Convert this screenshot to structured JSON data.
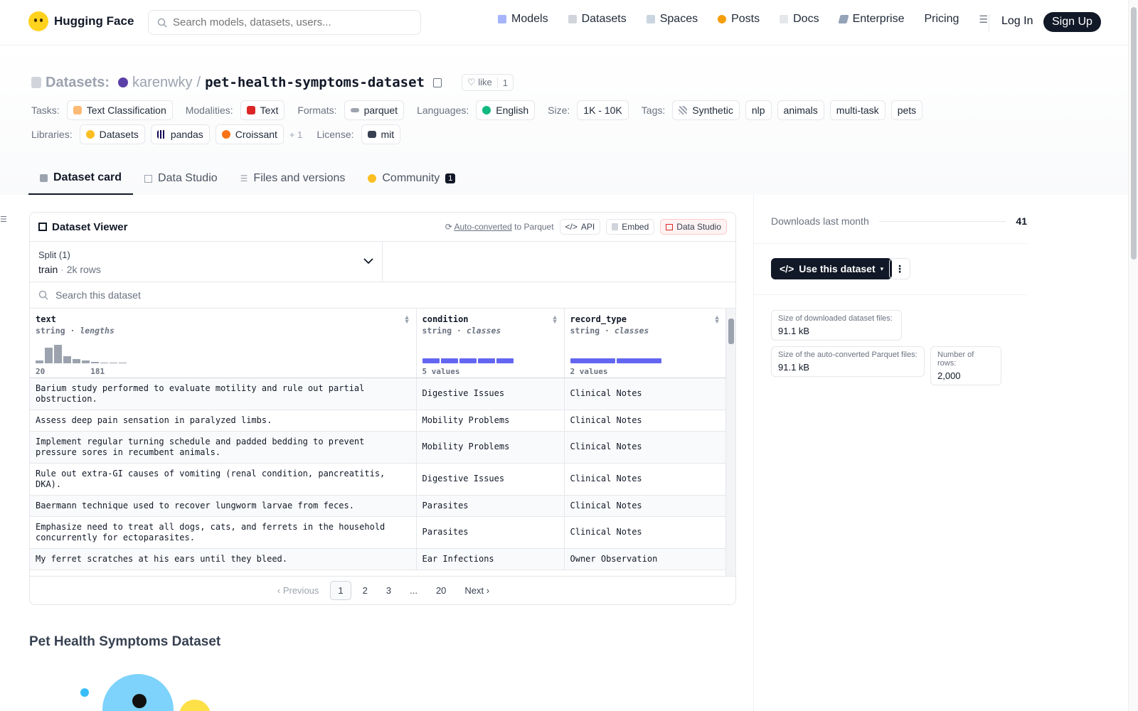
{
  "nav": {
    "brand": "Hugging Face",
    "search_placeholder": "Search models, datasets, users...",
    "links": [
      "Models",
      "Datasets",
      "Spaces",
      "Posts",
      "Docs",
      "Enterprise",
      "Pricing"
    ],
    "login": "Log In",
    "signup": "Sign Up"
  },
  "header": {
    "prefix": "Datasets:",
    "owner": "karenwky",
    "sep": "/",
    "name": "pet-health-symptoms-dataset",
    "like": "like",
    "like_count": "1",
    "tasks_label": "Tasks:",
    "task": "Text Classification",
    "modalities_label": "Modalities:",
    "modality": "Text",
    "formats_label": "Formats:",
    "format": "parquet",
    "languages_label": "Languages:",
    "language": "English",
    "size_label": "Size:",
    "size": "1K - 10K",
    "tags_label": "Tags:",
    "tags": [
      "Synthetic",
      "nlp",
      "animals",
      "multi-task",
      "pets"
    ],
    "libraries_label": "Libraries:",
    "libraries": [
      "Datasets",
      "pandas",
      "Croissant"
    ],
    "more_libs": "+ 1",
    "license_label": "License:",
    "license": "mit"
  },
  "tabs": [
    "Dataset card",
    "Data Studio",
    "Files and versions",
    "Community"
  ],
  "community_badge": "1",
  "viewer": {
    "title": "Dataset Viewer",
    "autoconv": "Auto-converted",
    "to_parquet": "to Parquet",
    "api": "API",
    "embed": "Embed",
    "studio": "Data Studio",
    "split_label": "Split (1)",
    "split": "train",
    "rows": "2k rows",
    "search_placeholder": "Search this dataset",
    "columns": [
      {
        "name": "text",
        "type": "string",
        "kind": "lengths",
        "foot": [
          "20",
          "181"
        ]
      },
      {
        "name": "condition",
        "type": "string",
        "kind": "classes",
        "foot": [
          "5 values"
        ]
      },
      {
        "name": "record_type",
        "type": "string",
        "kind": "classes",
        "foot": [
          "2 values"
        ]
      }
    ],
    "rows_data": [
      [
        "Barium study performed to evaluate motility and rule out partial obstruction.",
        "Digestive Issues",
        "Clinical Notes"
      ],
      [
        "Assess deep pain sensation in paralyzed limbs.",
        "Mobility Problems",
        "Clinical Notes"
      ],
      [
        "Implement regular turning schedule and padded bedding to prevent pressure sores in recumbent animals.",
        "Mobility Problems",
        "Clinical Notes"
      ],
      [
        "Rule out extra-GI causes of vomiting (renal condition, pancreatitis, DKA).",
        "Digestive Issues",
        "Clinical Notes"
      ],
      [
        "Baermann technique used to recover lungworm larvae from feces.",
        "Parasites",
        "Clinical Notes"
      ],
      [
        "Emphasize need to treat all dogs, cats, and ferrets in the household concurrently for ectoparasites.",
        "Parasites",
        "Clinical Notes"
      ],
      [
        "My ferret scratches at his ears until they bleed.",
        "Ear Infections",
        "Owner Observation"
      ]
    ],
    "pager": {
      "prev": "Previous",
      "pages": [
        "1",
        "2",
        "3",
        "...",
        "20"
      ],
      "next": "Next"
    }
  },
  "sidebar": {
    "downloads_label": "Downloads last month",
    "downloads": "41",
    "use_btn": "Use this dataset",
    "more": "⋮",
    "size_dl_label": "Size of downloaded dataset files:",
    "size_dl": "91.1 kB",
    "size_pq_label": "Size of the auto-converted Parquet files:",
    "size_pq": "91.1 kB",
    "nrows_label": "Number of rows:",
    "nrows": "2,000"
  },
  "readme_title": "Pet Health Symptoms Dataset"
}
